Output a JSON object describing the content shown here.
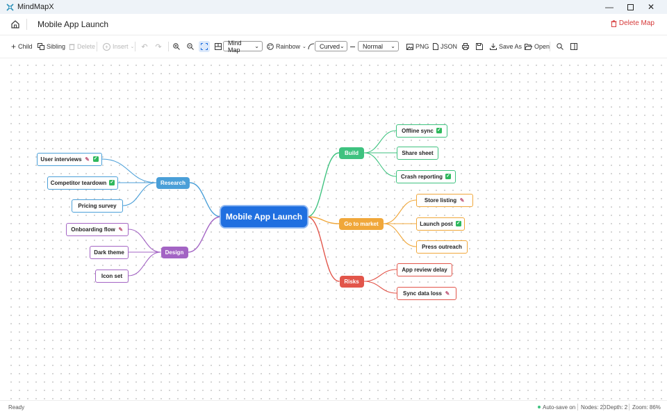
{
  "window": {
    "app_title": "MindMapX"
  },
  "header": {
    "map_title": "Mobile App Launch",
    "delete_label": "Delete Map"
  },
  "toolbar": {
    "child": "Child",
    "sibling": "Sibling",
    "delete": "Delete",
    "insert": "Insert",
    "layout": "Mind Map",
    "theme": "Rainbow",
    "edge": "Curved",
    "density": "Normal",
    "png": "PNG",
    "json": "JSON",
    "save_as": "Save As",
    "open": "Open"
  },
  "map": {
    "root": "Mobile App Launch",
    "branches": [
      {
        "label": "Research",
        "color": "#4a9fd8",
        "children": [
          {
            "label": "User interviews",
            "badges": [
              "pen",
              "check"
            ]
          },
          {
            "label": "Competitor teardown",
            "badges": [
              "check"
            ]
          },
          {
            "label": "Pricing survey",
            "badges": []
          }
        ]
      },
      {
        "label": "Design",
        "color": "#a364c4",
        "children": [
          {
            "label": "Onboarding flow",
            "badges": [
              "pen"
            ]
          },
          {
            "label": "Dark theme",
            "badges": []
          },
          {
            "label": "Icon set",
            "badges": []
          }
        ]
      },
      {
        "label": "Build",
        "color": "#3ec27f",
        "children": [
          {
            "label": "Offline sync",
            "badges": [
              "check"
            ]
          },
          {
            "label": "Share sheet",
            "badges": []
          },
          {
            "label": "Crash reporting",
            "badges": [
              "check"
            ]
          }
        ]
      },
      {
        "label": "Go to market",
        "color": "#f0a73a",
        "children": [
          {
            "label": "Store listing",
            "badges": [
              "pen"
            ]
          },
          {
            "label": "Launch post",
            "badges": [
              "check"
            ]
          },
          {
            "label": "Press outreach",
            "badges": []
          }
        ]
      },
      {
        "label": "Risks",
        "color": "#e2554a",
        "children": [
          {
            "label": "App review delay",
            "badges": []
          },
          {
            "label": "Sync data loss",
            "badges": [
              "pen"
            ]
          }
        ]
      }
    ]
  },
  "status": {
    "ready": "Ready",
    "autosave": "Auto-save on",
    "nodes": "Nodes: 20",
    "depth": "Depth: 2",
    "zoom": "Zoom: 86%"
  },
  "colors": {
    "accent": "#1f6fe0",
    "danger": "#d63a3a",
    "autosave_dot": "#3ec27f"
  }
}
